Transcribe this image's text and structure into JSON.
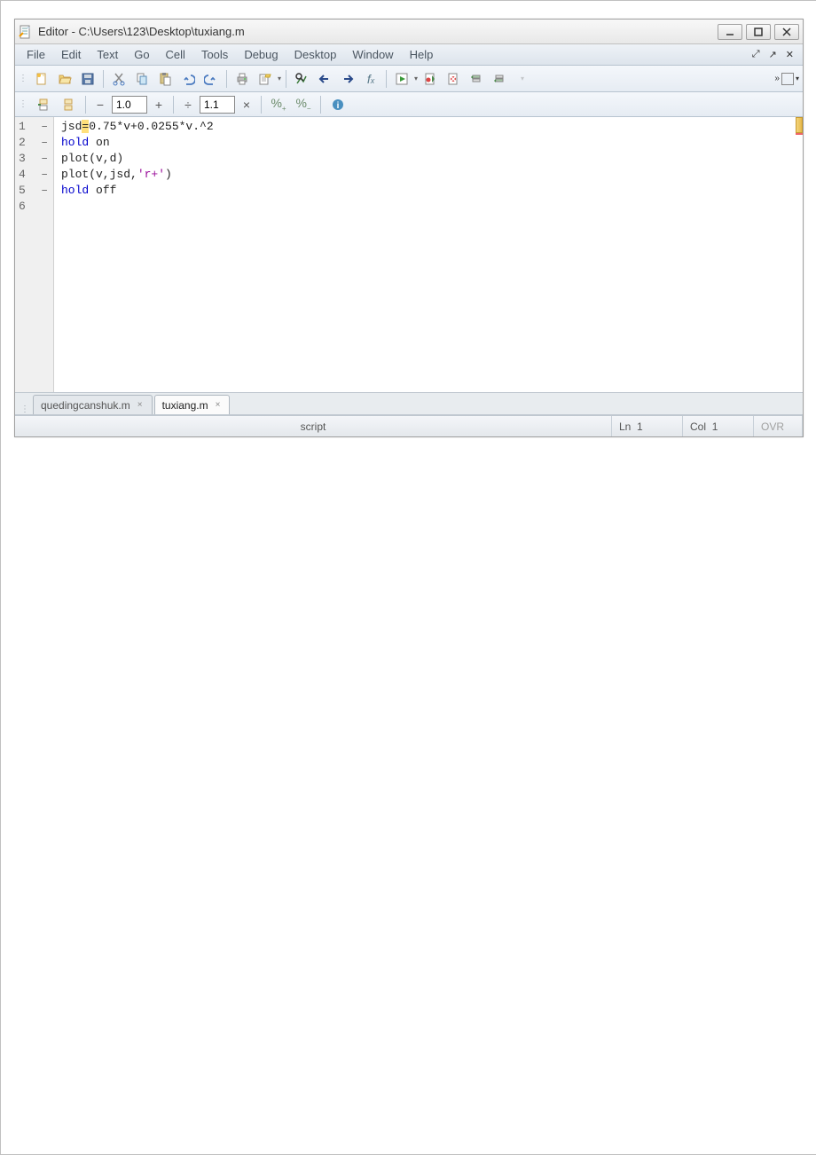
{
  "window": {
    "title": "Editor - C:\\Users\\123\\Desktop\\tuxiang.m"
  },
  "menu": {
    "items": [
      "File",
      "Edit",
      "Text",
      "Go",
      "Cell",
      "Tools",
      "Debug",
      "Desktop",
      "Window",
      "Help"
    ]
  },
  "toolbar_main": {
    "icons": [
      "new-file",
      "open-file",
      "save",
      "cut",
      "copy",
      "paste",
      "undo",
      "redo",
      "print",
      "publish",
      "find",
      "back",
      "forward",
      "function-hint",
      "run",
      "breakpoint-set",
      "breakpoint-clear",
      "stack-up",
      "stack-down"
    ]
  },
  "cell_toolbar": {
    "val1": "1.0",
    "val2": "1.1"
  },
  "code_lines": [
    {
      "n": "1",
      "dash": "–",
      "text_pre": "jsd",
      "eq": "=",
      "text_post": "0.75*v+0.0255*v.^2"
    },
    {
      "n": "2",
      "dash": "–",
      "kw1": "hold",
      "rest": " on"
    },
    {
      "n": "3",
      "dash": "–",
      "plain": "plot(v,d)"
    },
    {
      "n": "4",
      "dash": "–",
      "plain_pre": "plot(v,jsd,",
      "str": "'r+'",
      "plain_post": ")"
    },
    {
      "n": "5",
      "dash": "–",
      "kw1": "hold",
      "rest": " off"
    },
    {
      "n": "6",
      "dash": "",
      "plain": ""
    }
  ],
  "file_tabs": {
    "tab1": "quedingcanshuk.m",
    "tab2": "tuxiang.m"
  },
  "status": {
    "type": "script",
    "line_label": "Ln",
    "line_val": "1",
    "col_label": "Col",
    "col_val": "1",
    "ovr": "OVR"
  }
}
